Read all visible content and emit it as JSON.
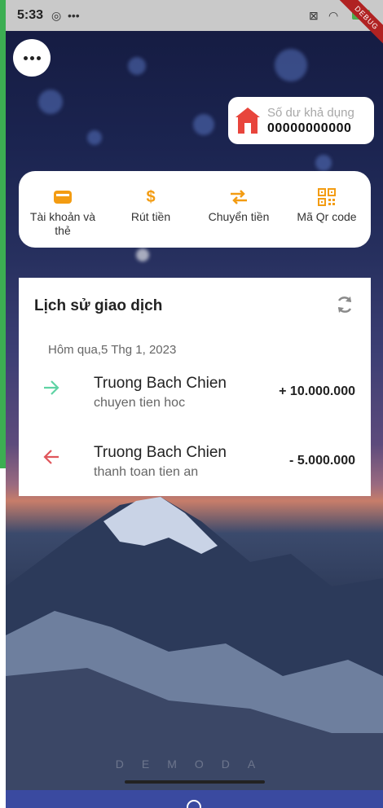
{
  "status_bar": {
    "time": "5:33",
    "battery": "100",
    "debug_label": "DEBUG"
  },
  "balance": {
    "label": "Số dư khả dụng",
    "value": "00000000000"
  },
  "actions": [
    {
      "label": "Tài khoản và thẻ",
      "icon": "card-icon"
    },
    {
      "label": "Rút tiền",
      "icon": "dollar-icon"
    },
    {
      "label": "Chuyển tiền",
      "icon": "transfer-icon"
    },
    {
      "label": "Mã Qr code",
      "icon": "qr-code-icon"
    }
  ],
  "history": {
    "title": "Lịch sử giao dịch",
    "date": "Hôm qua,5 Thg 1, 2023",
    "transactions": [
      {
        "name": "Truong Bach Chien",
        "description": "chuyen tien hoc",
        "amount": "+ 10.000.000",
        "direction": "in",
        "color": "#5fd3a4"
      },
      {
        "name": "Truong Bach Chien",
        "description": "thanh toan tien an",
        "amount": "- 5.000.000",
        "direction": "out",
        "color": "#e0565b"
      }
    ]
  },
  "watermark": "DEMODA",
  "colors": {
    "accent": "#f39c12",
    "home_icon": "#e8453c"
  }
}
